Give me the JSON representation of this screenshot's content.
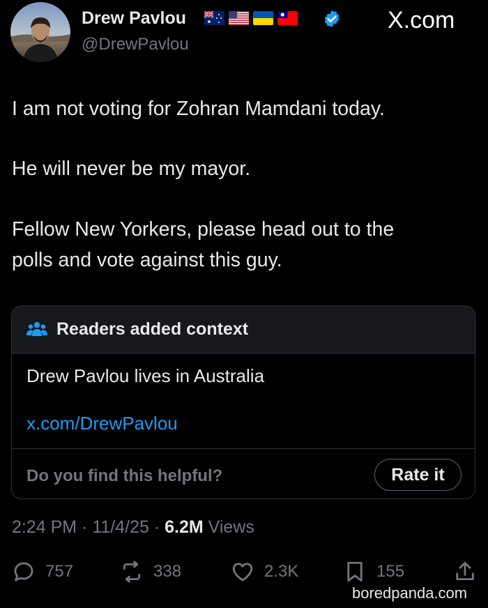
{
  "author": {
    "name": "Drew Pavlou",
    "handle": "@DrewPavlou",
    "flags": [
      "australia-flag-icon",
      "usa-flag-icon",
      "ukraine-flag-icon",
      "taiwan-flag-icon"
    ],
    "verified_icon": "verified-badge-icon"
  },
  "brand": "X.com",
  "tweet": {
    "lines": [
      "I am not voting for Zohran Mamdani today.",
      "He will never be my mayor.",
      "Fellow New Yorkers, please head out to the",
      "polls and vote against this guy."
    ]
  },
  "context": {
    "icon": "people-icon",
    "title": "Readers added context",
    "text": "Drew Pavlou lives in Australia",
    "link": "x.com/DrewPavlou",
    "question": "Do you find this helpful?",
    "button": "Rate it"
  },
  "meta": {
    "time": "2:24 PM",
    "sep": " · ",
    "date": "11/4/25",
    "views_count": "6.2M",
    "views_label": "Views"
  },
  "actions": {
    "replies": "757",
    "reposts": "338",
    "likes": "2.3K",
    "bookmarks": "155"
  },
  "watermark": "boredpanda.com",
  "colors": {
    "background": "#000000",
    "text": "#e7e9ea",
    "muted": "#71767b",
    "link": "#1d9bf0",
    "border": "#2f3336"
  }
}
